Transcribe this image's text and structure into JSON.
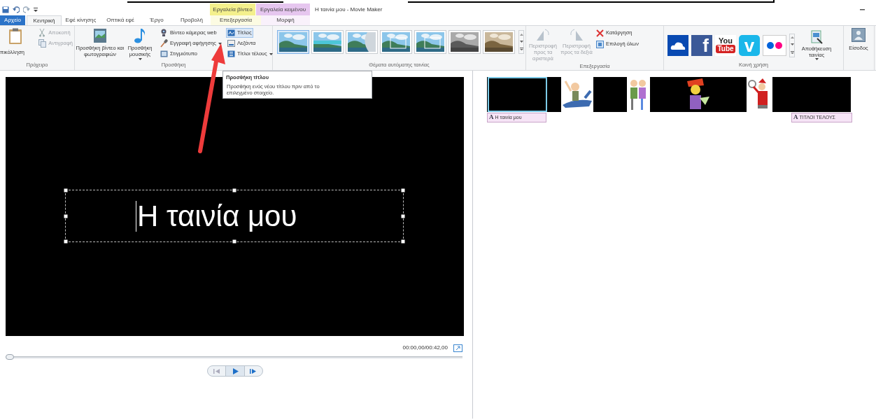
{
  "title_bar": {
    "contextual": [
      {
        "label": "Εργαλεία βίντεο",
        "color": "#f4f08c"
      },
      {
        "label": "Εργαλεία κειμένου",
        "color": "#e6c6ef"
      }
    ],
    "title": "Η ταινία μου - Movie Maker"
  },
  "tabs": [
    {
      "label": "Αρχείο",
      "kind": "file",
      "selected": false
    },
    {
      "label": "Κεντρική",
      "kind": "tab",
      "selected": true
    },
    {
      "label": "Εφέ κίνησης",
      "kind": "tab",
      "selected": false
    },
    {
      "label": "Οπτικά εφέ",
      "kind": "tab",
      "selected": false
    },
    {
      "label": "Έργο",
      "kind": "tab",
      "selected": false
    },
    {
      "label": "Προβολή",
      "kind": "tab",
      "selected": false
    },
    {
      "label": "Επεξεργασία",
      "kind": "tab",
      "selected": false
    },
    {
      "label": "Μορφή",
      "kind": "tab",
      "selected": false
    }
  ],
  "ribbon": {
    "clipboard": {
      "label": "Πρόχειρο",
      "paste": "πικόλληση",
      "items": [
        {
          "label": "Αποκοπή",
          "disabled": true
        },
        {
          "label": "Αντιγραφή",
          "disabled": true
        }
      ]
    },
    "add": {
      "label": "Προσθήκη",
      "large": [
        {
          "label": "Προσθήκη βίντεο και φωτογραφιών",
          "dropdown": false
        },
        {
          "label": "Προσθήκη μουσικής",
          "dropdown": true
        }
      ],
      "small": [
        {
          "label": "Βίντεο κάμερας web",
          "dropdown": false,
          "highlighted": false
        },
        {
          "label": "Εγγραφή αφήγησης",
          "dropdown": true,
          "highlighted": false
        },
        {
          "label": "Στιγμιότυπο",
          "dropdown": false,
          "highlighted": false
        },
        {
          "label": "Τίτλος",
          "dropdown": false,
          "highlighted": true
        },
        {
          "label": "Λεζάντα",
          "dropdown": false,
          "highlighted": false
        },
        {
          "label": "Τίτλοι τέλους",
          "dropdown": true,
          "highlighted": false
        }
      ]
    },
    "themes": {
      "label": "Θέματα αυτόματης ταινίας",
      "items": [
        {
          "kind": "color",
          "selected": true
        },
        {
          "kind": "color",
          "selected": false
        },
        {
          "kind": "color",
          "selected": false
        },
        {
          "kind": "color",
          "selected": false
        },
        {
          "kind": "color",
          "selected": false
        },
        {
          "kind": "gray",
          "selected": false
        },
        {
          "kind": "sepia",
          "selected": false
        }
      ]
    },
    "editing": {
      "label": "Επεξεργασία",
      "rotate": [
        {
          "label": "Περιστροφή προς τα αριστερά",
          "disabled": true
        },
        {
          "label": "Περιστροφή προς τα δεξιά",
          "disabled": true
        }
      ],
      "items": [
        {
          "label": "Κατάργηση"
        },
        {
          "label": "Επιλογή όλων"
        }
      ]
    },
    "share": {
      "label": "Κοινή χρήση",
      "services": [
        {
          "kind": "cloud"
        },
        {
          "kind": "facebook",
          "mark": "f"
        },
        {
          "kind": "youtube",
          "mark": "You",
          "mark_2": "Tube"
        },
        {
          "kind": "vimeo",
          "mark": "v"
        },
        {
          "kind": "flickr"
        }
      ],
      "save": "Αποθήκευση ταινίας"
    },
    "signin": {
      "label": "Είσοδος"
    }
  },
  "tooltip": {
    "title": "Προσθήκη τίτλου",
    "text": "Προσθήκη ενός νέου τίτλου πριν από το επιλεγμένο στοιχείο."
  },
  "preview": {
    "title_text": "Η ταινία μου",
    "time": "00:00,00/00:42,00",
    "seek": {
      "level": 0
    }
  },
  "storyboard": {
    "clips": [
      {
        "kind": "black",
        "selected": true
      },
      {
        "kind": "black",
        "selected": false
      },
      {
        "kind": "picture",
        "selected": false
      },
      {
        "kind": "black",
        "selected": false
      },
      {
        "kind": "picture",
        "selected": false
      },
      {
        "kind": "picture",
        "selected": false
      },
      {
        "kind": "picture",
        "selected": false
      },
      {
        "kind": "black",
        "selected": false
      }
    ],
    "captions": [
      {
        "glyph": "A",
        "text": "Η ταινία μου"
      },
      {
        "glyph": "A",
        "text": "ΤΙΤΛΟΙ ΤΕΛΟΥΣ"
      }
    ]
  }
}
